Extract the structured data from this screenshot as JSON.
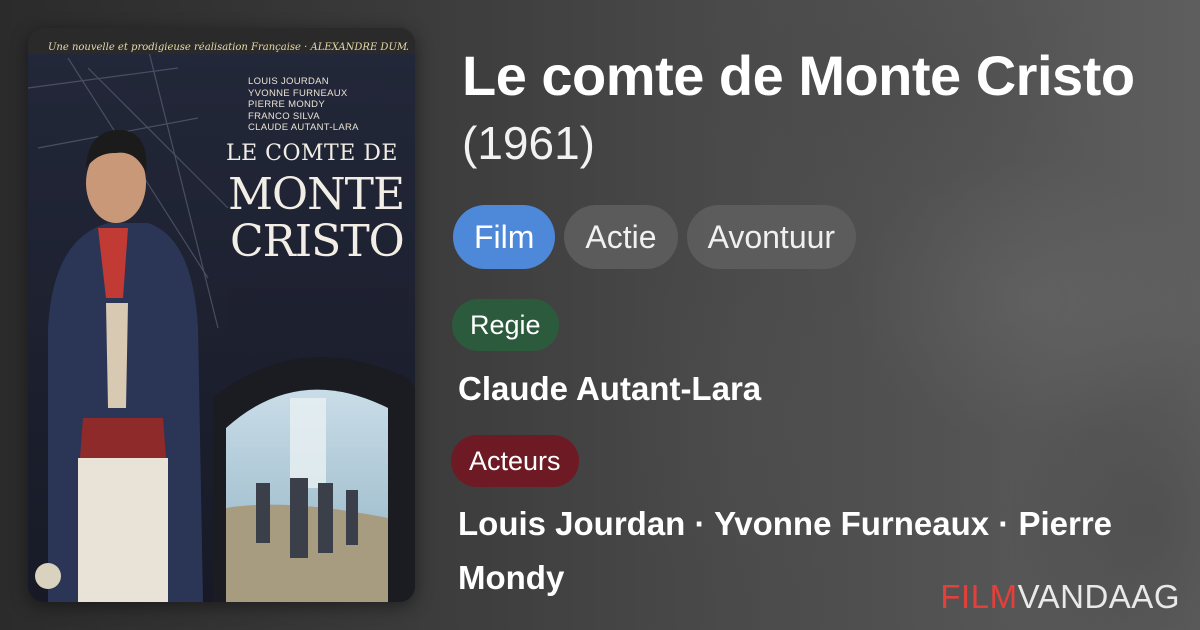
{
  "movie": {
    "title": "Le comte de Monte Cristo",
    "year": "(1961)"
  },
  "genres": [
    "Film",
    "Actie",
    "Avontuur"
  ],
  "regie": {
    "label": "Regie",
    "value": "Claude Autant-Lara"
  },
  "acteurs": {
    "label": "Acteurs",
    "value": "Louis Jourdan · Yvonne Furneaux · Pierre Mondy"
  },
  "poster": {
    "credits_top": "Une nouvelle et prodigieuse réalisation Française · ALEXANDRE DUMAS",
    "cast": [
      "LOUIS JOURDAN",
      "YVONNE FURNEAUX",
      "PIERRE MONDY",
      "FRANCO SILVA",
      "CLAUDE AUTANT-LARA"
    ],
    "title_line1": "LE COMTE DE",
    "title_line2": "MONTE",
    "title_line3": "CRISTO"
  },
  "logo": {
    "part1": "FILM",
    "part2": "VANDAAG"
  },
  "colors": {
    "genre_active": "#4e88d9",
    "genre_default": "#5f5f5f",
    "regie_badge": "#2c5a3c",
    "acteurs_badge": "#6e1a24",
    "logo_accent": "#e2413b"
  }
}
